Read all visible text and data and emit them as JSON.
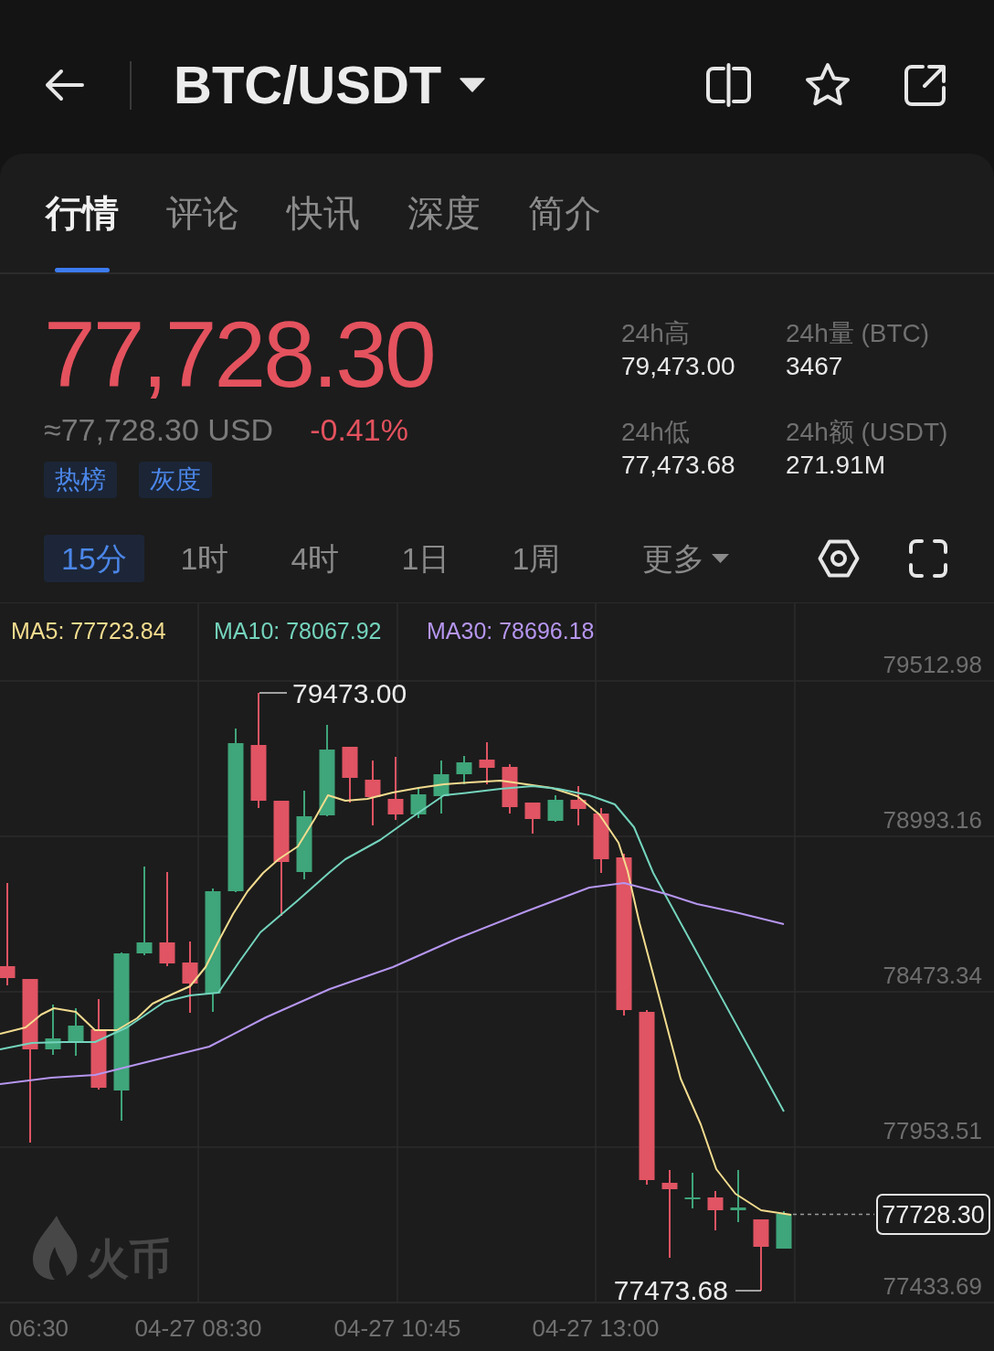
{
  "header": {
    "title": "BTC/USDT",
    "favorite": false
  },
  "tabs": [
    {
      "label": "行情",
      "selected": true
    },
    {
      "label": "评论",
      "selected": false
    },
    {
      "label": "快讯",
      "selected": false
    },
    {
      "label": "深度",
      "selected": false
    },
    {
      "label": "简介",
      "selected": false
    }
  ],
  "ticker": {
    "price": "77,728.30",
    "falling": true,
    "fiat": "≈77,728.30 USD",
    "change": "-0.41%",
    "tags": [
      "热榜",
      "灰度"
    ]
  },
  "stats": [
    {
      "label": "24h高",
      "value": "79,473.00"
    },
    {
      "label": "24h量 (BTC)",
      "value": "3467"
    },
    {
      "label": "24h低",
      "value": "77,473.68"
    },
    {
      "label": "24h额 (USDT)",
      "value": "271.91M"
    }
  ],
  "intervals": [
    {
      "label": "15分",
      "selected": true,
      "kind": "interval"
    },
    {
      "label": "1时",
      "selected": false,
      "kind": "interval"
    },
    {
      "label": "4时",
      "selected": false,
      "kind": "interval"
    },
    {
      "label": "1日",
      "selected": false,
      "kind": "interval"
    },
    {
      "label": "1周",
      "selected": false,
      "kind": "interval"
    },
    {
      "label": "更多",
      "selected": false,
      "kind": "menu"
    }
  ],
  "chart": {
    "legend": [
      {
        "label": "MA5: 77723.84",
        "color": "#f3dc8f"
      },
      {
        "label": "MA10: 78067.92",
        "color": "#74d4bd"
      },
      {
        "label": "MA30: 78696.18",
        "color": "#b696f0"
      }
    ],
    "y_axis": [
      "79512.98",
      "78993.16",
      "78473.34",
      "77953.51",
      "77433.69"
    ],
    "x_axis": [
      "06:30",
      "04-27 08:30",
      "04-27 10:45",
      "04-27 13:00"
    ],
    "high_label": "79473.00",
    "low_label": "77473.68",
    "last_price": "77728.30",
    "watermark": "火币"
  }
}
